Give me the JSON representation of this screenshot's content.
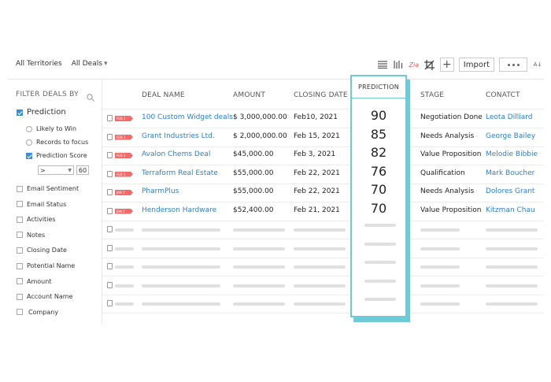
{
  "topbar": {
    "territories": "All Territories",
    "deals": "All Deals"
  },
  "toolbar": {
    "import_label": "Import",
    "plus_label": "+"
  },
  "filter": {
    "title": "FILTER DEALS BY",
    "prediction": "Prediction",
    "likely": "Likely to Win",
    "records": "Records to focus",
    "score": "Prediction Score",
    "operator": ">",
    "value": "60",
    "fields": [
      "Email Sentiment",
      "Email Status",
      "Activities",
      "Notes",
      "Closing Date",
      "Potential Name",
      "Amount",
      "Account Name",
      "Company"
    ]
  },
  "columns": {
    "deal_name": "DEAL NAME",
    "amount": "AMOUNT",
    "closing_date": "CLOSING DATE",
    "prediction": "PREDICTION",
    "stage": "STAGE",
    "contact": "CONATCT"
  },
  "rows": [
    {
      "tag": "FEB 1",
      "name": "100 Custom Widget deals",
      "amount": "$ 3,000,000.00",
      "date": "Feb10, 2021",
      "score": "90",
      "stage": "Negotiation Done",
      "contact": "Leota Dilliard"
    },
    {
      "tag": "FEB 1",
      "name": "Grant Industries Ltd.",
      "amount": "$ 2,000,000.00",
      "date": "Feb 15, 2021",
      "score": "85",
      "stage": "Needs Analysis",
      "contact": "George Bailey"
    },
    {
      "tag": "FEB 1",
      "name": "Avalon Chems Deal",
      "amount": "$45,000.00",
      "date": "Feb 3, 2021",
      "score": "82",
      "stage": "Value Proposition",
      "contact": "Melodie Bibbie"
    },
    {
      "tag": "FEB 1",
      "name": "Terraform Real Estate",
      "amount": "$55,000.00",
      "date": "Feb 22, 2021",
      "score": "76",
      "stage": "Qualification",
      "contact": "Mark Boucher"
    },
    {
      "tag": "JAN 2",
      "name": "PharmPlus",
      "amount": "$55,000.00",
      "date": "Feb 22, 2021",
      "score": "70",
      "stage": "Needs Analysis",
      "contact": "Dolores Grant"
    },
    {
      "tag": "JAN 2",
      "name": "Henderson Hardware",
      "amount": "$52,400.00",
      "date": "Feb 21, 2021",
      "score": "70",
      "stage": "Value Proposition",
      "contact": "Kitzman Chau"
    }
  ]
}
